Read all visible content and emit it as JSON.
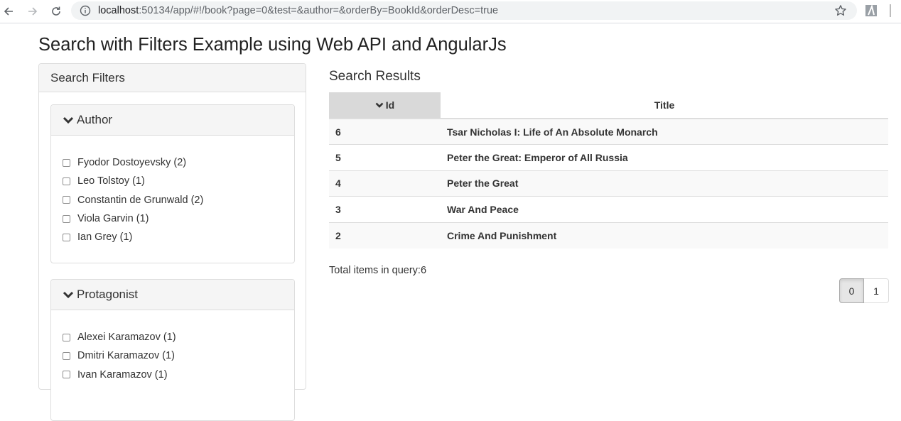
{
  "browser": {
    "url_host": "localhost",
    "url_rest": ":50134/app/#!/book?page=0&test=&author=&orderBy=BookId&orderDesc=true"
  },
  "page": {
    "title": "Search with Filters Example using Web API and AngularJs"
  },
  "filters": {
    "heading": "Search Filters",
    "author": {
      "title": "Author",
      "items": [
        {
          "label": "Fyodor Dostoyevsky (2)",
          "checked": false
        },
        {
          "label": "Leo Tolstoy (1)",
          "checked": false
        },
        {
          "label": "Constantin de Grunwald (2)",
          "checked": false
        },
        {
          "label": "Viola Garvin (1)",
          "checked": false
        },
        {
          "label": "Ian Grey (1)",
          "checked": false
        }
      ]
    },
    "protagonist": {
      "title": "Protagonist",
      "items": [
        {
          "label": "Alexei Karamazov (1)",
          "checked": false
        },
        {
          "label": "Dmitri Karamazov (1)",
          "checked": false
        },
        {
          "label": "Ivan Karamazov (1)",
          "checked": false
        }
      ]
    }
  },
  "results": {
    "title": "Search Results",
    "columns": [
      "Id",
      "Title"
    ],
    "sorted_column": "Id",
    "sort_direction": "desc",
    "rows": [
      {
        "id": "6",
        "title": "Tsar Nicholas I: Life of An Absolute Monarch"
      },
      {
        "id": "5",
        "title": "Peter the Great: Emperor of All Russia"
      },
      {
        "id": "4",
        "title": "Peter the Great"
      },
      {
        "id": "3",
        "title": "War And Peace"
      },
      {
        "id": "2",
        "title": "Crime And Punishment"
      }
    ],
    "total_text": "Total items in query:6"
  },
  "pagination": {
    "pages": [
      "0",
      "1"
    ],
    "active": "0"
  },
  "icons": {
    "back": "arrow-left-icon",
    "forward": "arrow-right-icon",
    "reload": "reload-icon",
    "site_info": "info-icon",
    "bookmark": "star-icon",
    "extension": "extension-icon",
    "collapse": "chevron-down-icon"
  }
}
